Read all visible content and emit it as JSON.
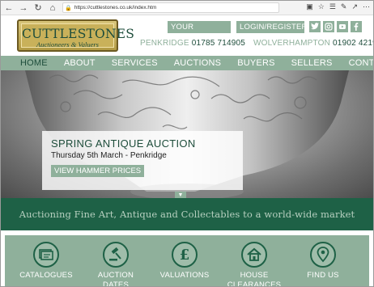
{
  "browser": {
    "url": "https://cuttlestones.co.uk/index.htm"
  },
  "logo": {
    "title": "CUTTLESTONES",
    "subtitle": "Auctioneers & Valuers"
  },
  "header": {
    "account_label": "YOUR ACCOUNT",
    "login_label": "LOGIN/REGISTER",
    "phones": [
      {
        "town": "PENKRIDGE",
        "number": "01785 714905"
      },
      {
        "town": "WOLVERHAMPTON",
        "number": "01902 421985"
      }
    ],
    "social": [
      "twitter-icon",
      "instagram-icon",
      "youtube-icon",
      "facebook-icon"
    ]
  },
  "nav": {
    "items": [
      "HOME",
      "ABOUT",
      "SERVICES",
      "AUCTIONS",
      "BUYERS",
      "SELLERS",
      "CONTACT"
    ],
    "active": "HOME"
  },
  "hero": {
    "title": "SPRING ANTIQUE AUCTION",
    "date": "Thursday 5th March - Penkridge",
    "button_label": "VIEW HAMMER PRICES"
  },
  "tagline": "Auctioning Fine Art, Antique and Collectables to a world-wide market",
  "services": {
    "items": [
      {
        "label1": "CATALOGUES",
        "label2": "",
        "icon": "catalogue-icon"
      },
      {
        "label1": "AUCTION",
        "label2": "DATES",
        "icon": "gavel-icon"
      },
      {
        "label1": "VALUATIONS",
        "label2": "",
        "icon": "pound-icon"
      },
      {
        "label1": "HOUSE",
        "label2": "CLEARANCES",
        "icon": "house-icon"
      },
      {
        "label1": "FIND US",
        "label2": "",
        "icon": "location-pin-icon"
      }
    ]
  },
  "colors": {
    "brand_green": "#1e6146",
    "sage": "#8fb09b",
    "gold": "#c9b15a"
  }
}
